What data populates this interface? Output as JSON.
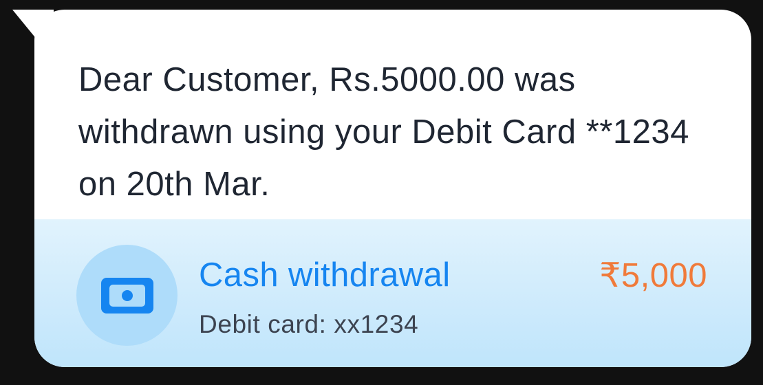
{
  "message": {
    "text": "Dear Customer, Rs.5000.00 was withdrawn using your Debit Card **1234 on 20th Mar."
  },
  "transaction": {
    "icon": "banknote-icon",
    "title": "Cash withdrawal",
    "subtitle": "Debit card: xx1234",
    "amount": "₹5,000"
  },
  "colors": {
    "title": "#1685f0",
    "amount": "#f07a3a",
    "message_text": "#1f2632",
    "subtitle_text": "#3c4350",
    "icon": "#1685f0",
    "icon_bg": "#aedcfa",
    "panel_bg": "#d6eefc"
  }
}
